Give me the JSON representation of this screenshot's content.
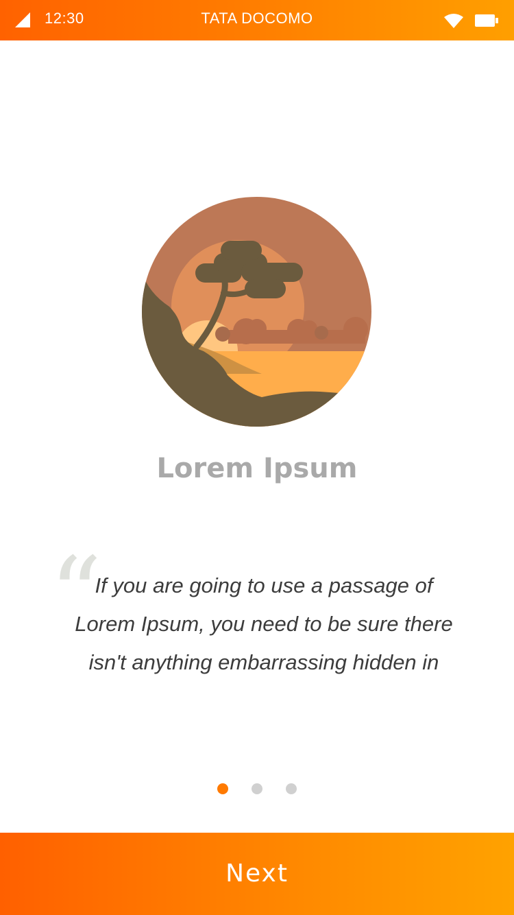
{
  "status_bar": {
    "time": "12:30",
    "carrier": "TATA DOCOMO",
    "icons": [
      "signal-icon",
      "wifi-icon",
      "battery-icon"
    ]
  },
  "illustration": {
    "name": "savanna-sunset-illustration"
  },
  "title": "Lorem Ipsum",
  "quote": {
    "text": "If you are going to use a passage of Lorem Ipsum, you need to be sure there isn't anything embarrassing hidden in"
  },
  "pager": {
    "count": 3,
    "active_index": 0
  },
  "next_button": {
    "label": "Next"
  },
  "colors": {
    "accent_start": "#ff6000",
    "accent_end": "#ffa200",
    "title": "#a9a9a9",
    "quote_text": "#3c3c3c",
    "dot_active": "#ff7a00",
    "dot_inactive": "#d0d0d0"
  }
}
